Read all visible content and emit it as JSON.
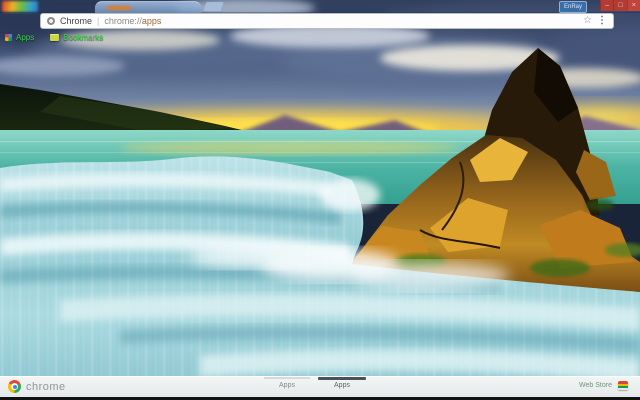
{
  "window": {
    "badge_label": "EnRay",
    "controls": [
      {
        "name": "minimize",
        "glyph": "–"
      },
      {
        "name": "restore",
        "glyph": "□"
      },
      {
        "name": "close",
        "glyph": "×"
      }
    ]
  },
  "tabstrip": {
    "active_tab_title_color": "#e07a28"
  },
  "omnibox": {
    "engine_label": "Chrome",
    "separator": "|",
    "url_scheme": "chrome://",
    "url_host": "apps",
    "star_glyph": "☆",
    "menu_glyph": "⋮"
  },
  "bookmarks_bar": {
    "items": [
      {
        "label": "Apps",
        "icon": "apps-grid-icon"
      },
      {
        "label": "Bookmarks",
        "icon": "bookmarks-folder-icon"
      }
    ]
  },
  "launcher": {
    "brand": "chrome",
    "nav": [
      {
        "label": "Apps",
        "selected": false
      },
      {
        "label": "Apps",
        "selected": true
      }
    ],
    "web_store_label": "Web Store"
  },
  "colors": {
    "window_controls_red": "#b23b34",
    "badge_blue": "#3a6ea8",
    "bookmark_text_green": "#3fd04f",
    "launcher_bg": "#e9eceb",
    "sea_teal": "#3aa392",
    "rock_amber": "#c08a24",
    "waterfall_cyan": "#9fd4da",
    "sunset_yellow": "#f5d242"
  }
}
